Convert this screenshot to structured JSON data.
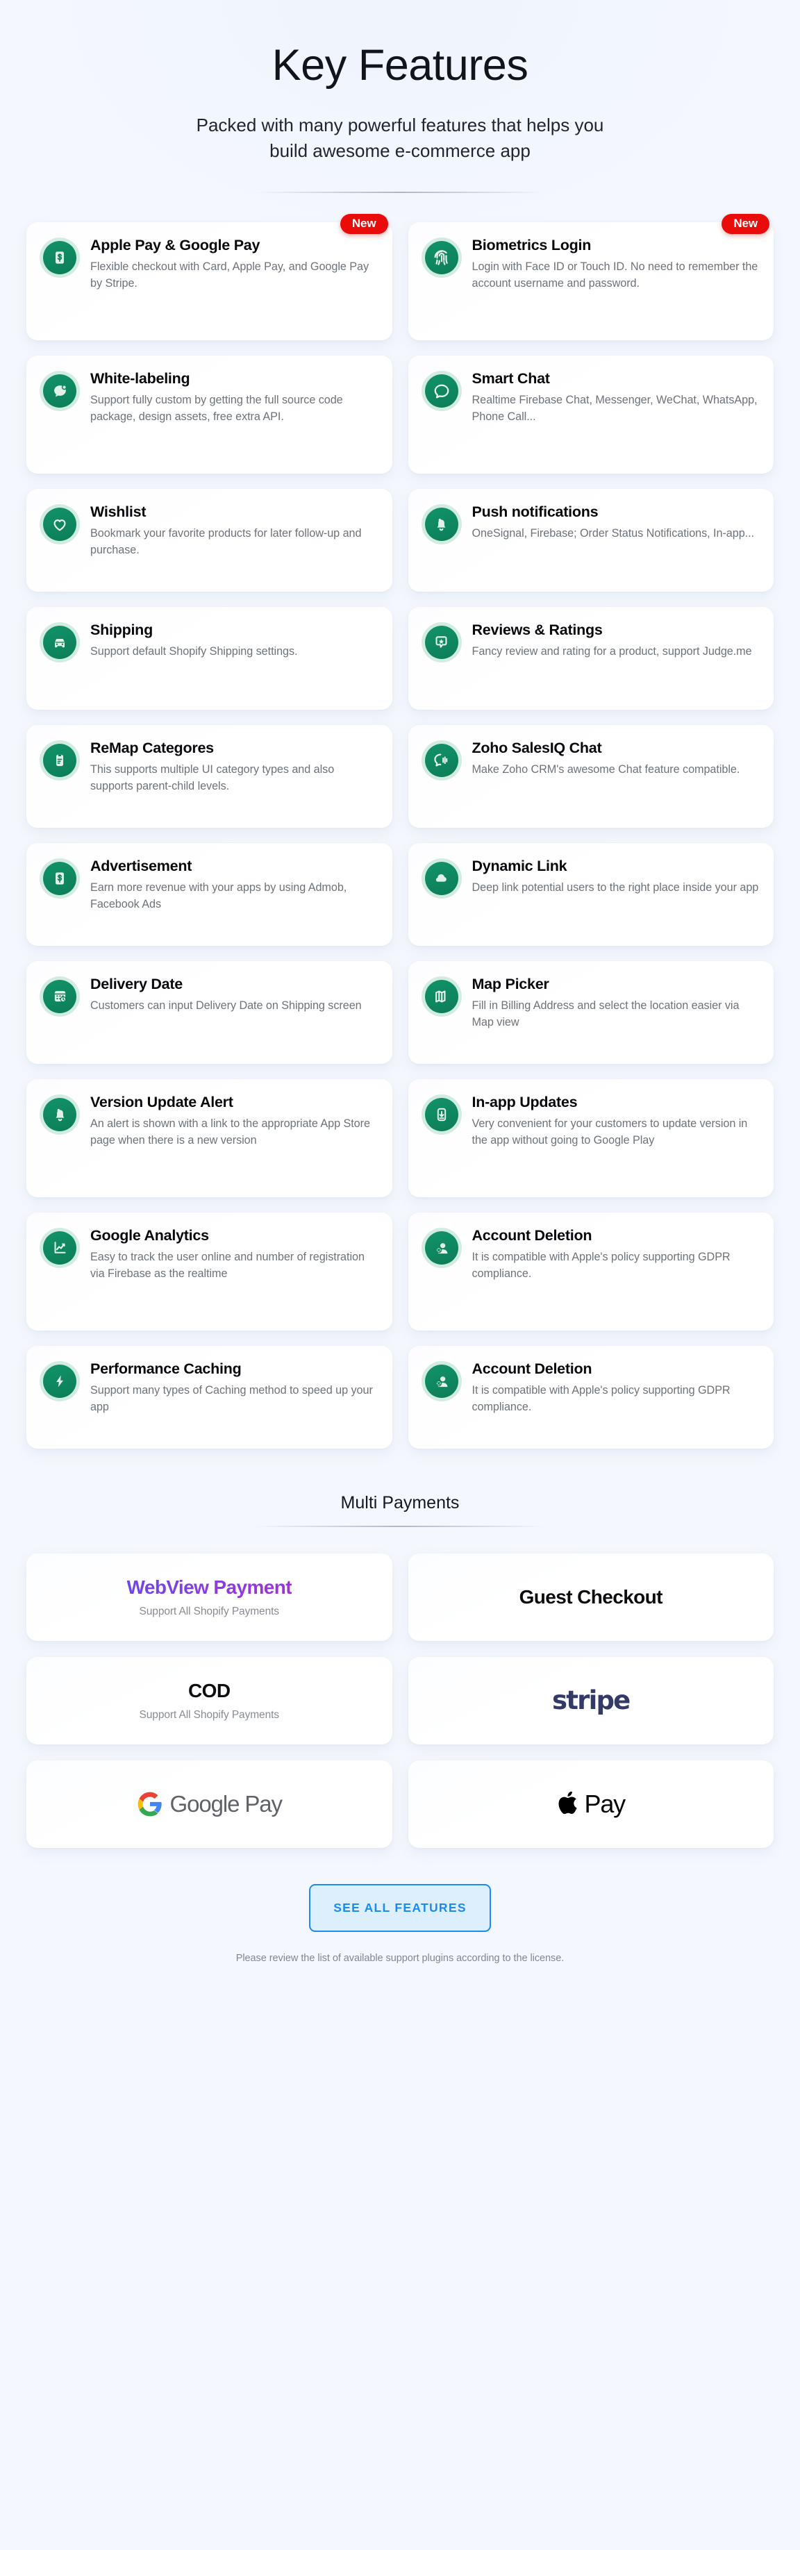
{
  "hero": {
    "title": "Key Features",
    "subtitle_line1": "Packed with many powerful features that helps you",
    "subtitle_line2": "build awesome e-commerce app"
  },
  "colors": {
    "page_background": "#f4f7fd",
    "icon_circle": "#0c7d58",
    "icon_halo": "#d3ece1",
    "badge_new": "#ea0b0b",
    "cta_accent": "#1a8bf0",
    "cta_fill": "#ddeefd",
    "webview_gradient_start": "#6f46e8",
    "webview_gradient_end": "#9b33d6",
    "stripe_logo": "#343a68",
    "google_pay_text": "#5f6368"
  },
  "features": [
    {
      "title": "Apple Pay & Google Pay",
      "desc": "Flexible checkout with Card, Apple Pay, and Google Pay by Stripe.",
      "icon": "dollar-card-icon",
      "badge": "New"
    },
    {
      "title": "Biometrics Login",
      "desc": "Login with Face ID or Touch ID. No need to remember the account username and password.",
      "icon": "fingerprint-icon",
      "badge": "New"
    },
    {
      "title": "White-labeling",
      "desc": "Support fully custom by getting the full source code package, design assets, free extra API.",
      "icon": "chat-bubble-dot-icon",
      "badge": null
    },
    {
      "title": "Smart Chat",
      "desc": "Realtime Firebase Chat, Messenger, WeChat, WhatsApp, Phone Call...",
      "icon": "chat-bubble-icon",
      "badge": null
    },
    {
      "title": "Wishlist",
      "desc": "Bookmark your favorite products for later follow-up and purchase.",
      "icon": "heart-icon",
      "badge": null
    },
    {
      "title": "Push notifications",
      "desc": "OneSignal, Firebase; Order Status Notifications, In-app...",
      "icon": "bell-icon",
      "badge": null
    },
    {
      "title": "Shipping",
      "desc": "Support default Shopify Shipping settings.",
      "icon": "truck-icon",
      "badge": null
    },
    {
      "title": "Reviews & Ratings",
      "desc": "Fancy review and rating for a product, support Judge.me",
      "icon": "star-bubble-icon",
      "badge": null
    },
    {
      "title": "ReMap Categores",
      "desc": "This supports multiple UI category types and also supports parent-child levels.",
      "icon": "clipboard-icon",
      "badge": null
    },
    {
      "title": "Zoho SalesIQ Chat",
      "desc": "Make Zoho CRM's awesome Chat feature compatible.",
      "icon": "chat-waveform-icon",
      "badge": null
    },
    {
      "title": "Advertisement",
      "desc": "Earn more revenue with your apps by using Admob, Facebook Ads",
      "icon": "dollar-card-icon",
      "badge": null
    },
    {
      "title": "Dynamic Link",
      "desc": "Deep link potential users to the right place inside your app",
      "icon": "cloud-icon",
      "badge": null
    },
    {
      "title": "Delivery Date",
      "desc": "Customers can input Delivery Date on Shipping screen",
      "icon": "calendar-clock-icon",
      "badge": null
    },
    {
      "title": "Map Picker",
      "desc": "Fill in Billing Address and select the location easier via Map view",
      "icon": "map-icon",
      "badge": null
    },
    {
      "title": "Version Update Alert",
      "desc": "An alert is shown with a link to the appropriate App Store page when there is a new version",
      "icon": "bell-icon",
      "badge": null
    },
    {
      "title": "In-app Updates",
      "desc": "Very convenient for your customers to update version in the app without going to Google Play",
      "icon": "download-phone-icon",
      "badge": null
    },
    {
      "title": "Google Analytics",
      "desc": "Easy to track the user online and number of registration via Firebase as the realtime",
      "icon": "line-chart-icon",
      "badge": null
    },
    {
      "title": "Account Deletion",
      "desc": "It is compatible with Apple's policy supporting GDPR compliance.",
      "icon": "user-delete-icon",
      "badge": null
    },
    {
      "title": "Performance Caching",
      "desc": "Support many types of Caching method to speed up your app",
      "icon": "lightning-icon",
      "badge": null
    },
    {
      "title": "Account Deletion",
      "desc": "It is compatible with Apple's policy supporting GDPR compliance.",
      "icon": "user-delete-icon",
      "badge": null
    }
  ],
  "multi_payments": {
    "section_title": "Multi Payments",
    "cards": [
      {
        "kind": "text-gradient",
        "label": "WebView Payment",
        "sub": "Support All Shopify Payments"
      },
      {
        "kind": "text",
        "label": "Guest Checkout",
        "sub": ""
      },
      {
        "kind": "text",
        "label": "COD",
        "sub": "Support All Shopify Payments"
      },
      {
        "kind": "stripe",
        "label": "stripe",
        "sub": ""
      },
      {
        "kind": "google-pay",
        "label": "Google Pay",
        "sub": ""
      },
      {
        "kind": "apple-pay",
        "label": "Pay",
        "sub": ""
      }
    ]
  },
  "footer": {
    "cta_label": "SEE ALL FEATURES",
    "note": "Please review the list of available support plugins according to the license."
  }
}
